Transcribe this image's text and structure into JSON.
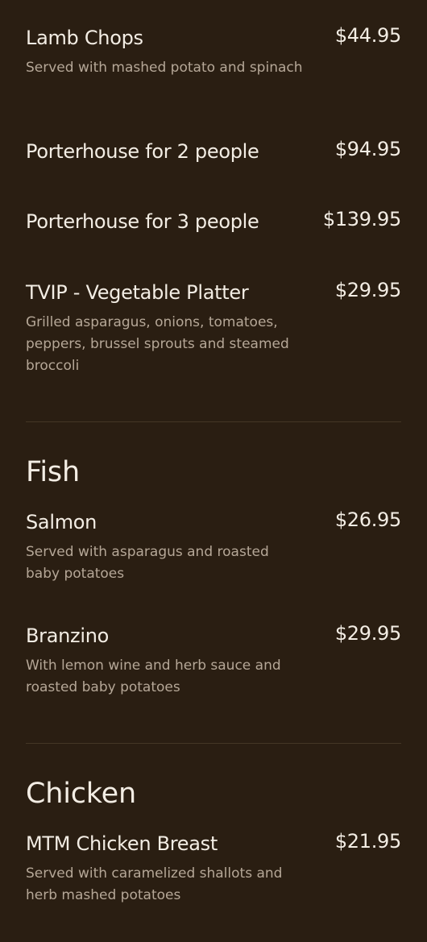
{
  "sections": [
    {
      "items": [
        {
          "name": "Lamb Chops",
          "price": "$44.95",
          "description": "Served with mashed potato and spinach"
        },
        {
          "name": "Porterhouse for 2 people",
          "price": "$94.95",
          "description": ""
        },
        {
          "name": "Porterhouse for 3 people",
          "price": "$139.95",
          "description": ""
        },
        {
          "name": "TVIP - Vegetable Platter",
          "price": "$29.95",
          "description": "Grilled asparagus, onions, tomatoes, peppers, brussel sprouts and steamed broccoli"
        }
      ]
    },
    {
      "heading": "Fish",
      "items": [
        {
          "name": "Salmon",
          "price": "$26.95",
          "description": "Served with asparagus and roasted baby potatoes"
        },
        {
          "name": "Branzino",
          "price": "$29.95",
          "description": "With lemon wine and herb sauce and roasted baby potatoes"
        }
      ]
    },
    {
      "heading": "Chicken",
      "items": [
        {
          "name": "MTM Chicken Breast",
          "price": "$21.95",
          "description": "Served with caramelized shallots and herb mashed potatoes"
        }
      ]
    }
  ],
  "colors": {
    "background": "#2a1e12",
    "text": "#f3ede4",
    "description_text": "#b5a797",
    "divider": "#443625"
  }
}
